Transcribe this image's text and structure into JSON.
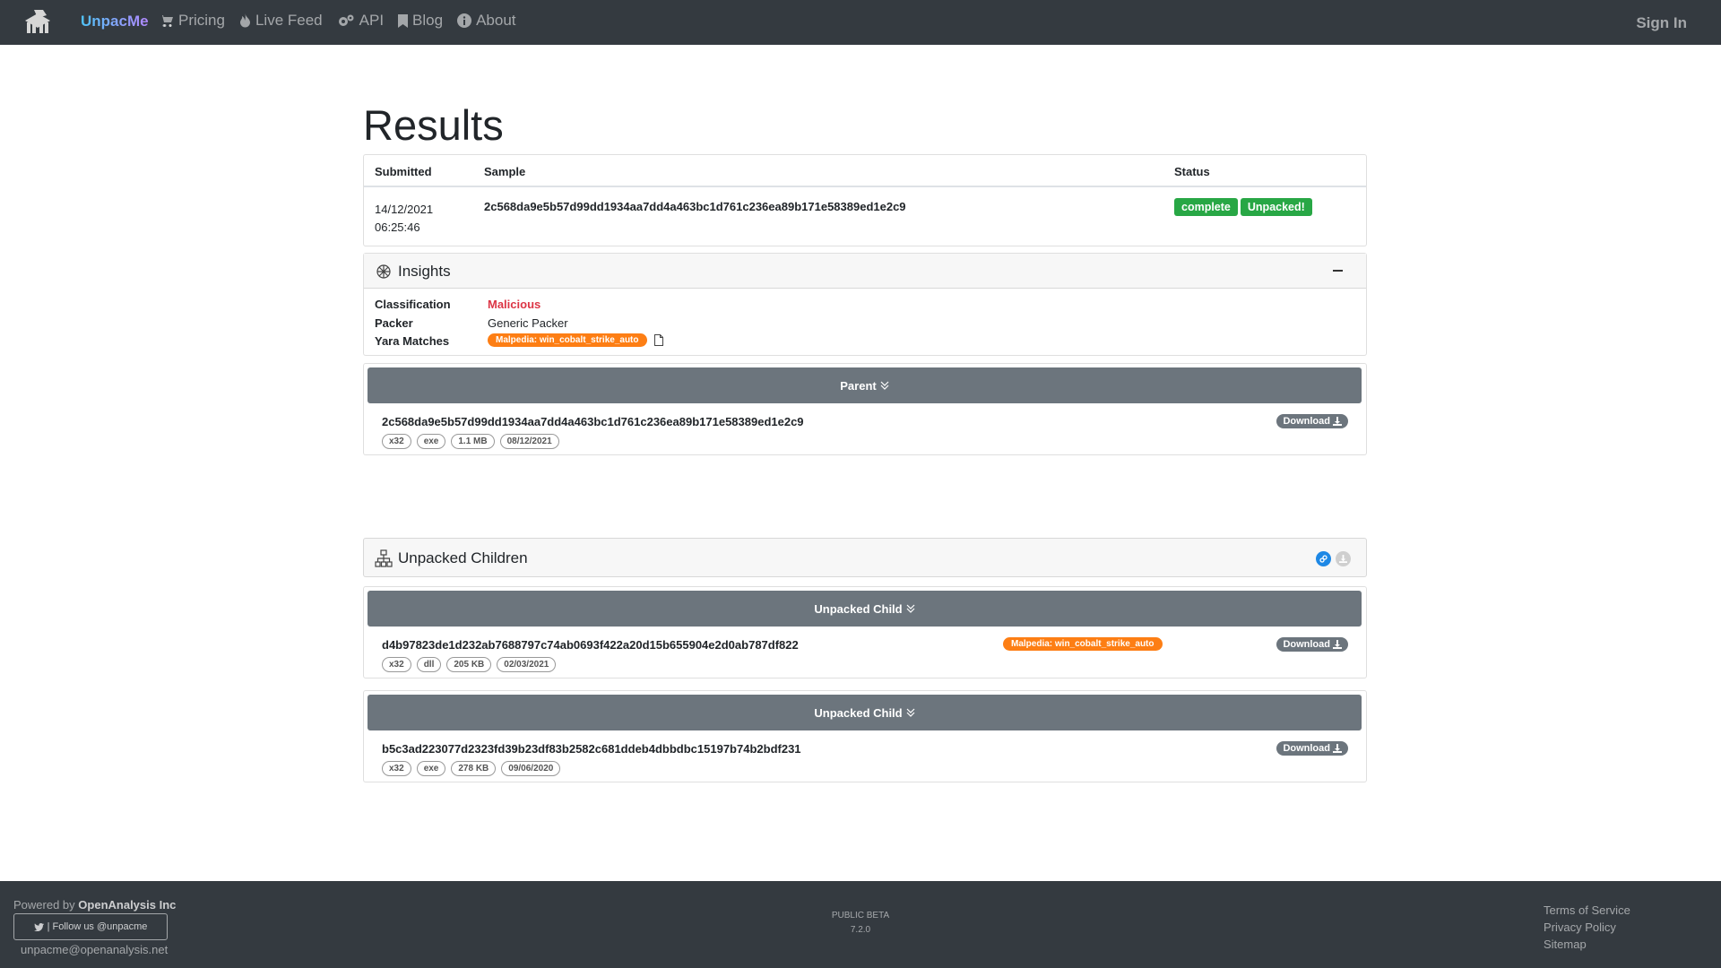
{
  "nav": {
    "brand": "UnpacMe",
    "links": [
      {
        "label": "Pricing",
        "icon": "cart-icon"
      },
      {
        "label": "Live Feed",
        "icon": "fire-icon"
      },
      {
        "label": "API",
        "icon": "cogs-icon"
      },
      {
        "label": "Blog",
        "icon": "bookmark-icon"
      },
      {
        "label": "About",
        "icon": "info-icon"
      }
    ],
    "signin": "Sign In"
  },
  "page": {
    "title": "Results"
  },
  "results": {
    "headers": {
      "submitted": "Submitted",
      "sample": "Sample",
      "status": "Status"
    },
    "submitted_date": "14/12/2021",
    "submitted_time": "06:25:46",
    "sample": "2c568da9e5b57d99dd1934aa7dd4a463bc1d761c236ea89b171e58389ed1e2c9",
    "status": [
      "complete",
      "Unpacked!"
    ],
    "status_color": "#28a745"
  },
  "insights": {
    "title": "Insights",
    "classification_label": "Classification",
    "classification": "Malicious",
    "packer_label": "Packer",
    "packer": "Generic Packer",
    "yara_label": "Yara Matches",
    "yara": "Malpedia: win_cobalt_strike_auto",
    "malicious_color": "#dc3545",
    "yara_color": "#fd7e14"
  },
  "parent": {
    "bar_label": "Parent",
    "hash": "2c568da9e5b57d99dd1934aa7dd4a463bc1d761c236ea89b171e58389ed1e2c9",
    "tags": [
      "x32",
      "exe",
      "1.1 MB",
      "08/12/2021"
    ],
    "download": "Download"
  },
  "children": {
    "title": "Unpacked Children",
    "items": [
      {
        "bar_label": "Unpacked Child",
        "hash": "d4b97823de1d232ab7688797c74ab0693f422a20d15b655904e2d0ab787df822",
        "yara": "Malpedia: win_cobalt_strike_auto",
        "tags": [
          "x32",
          "dll",
          "205 KB",
          "02/03/2021"
        ],
        "download": "Download"
      },
      {
        "bar_label": "Unpacked Child",
        "hash": "b5c3ad223077d2323fd39b23df83b2582c681ddeb4dbbdbc15197b74b2bdf231",
        "tags": [
          "x32",
          "exe",
          "278 KB",
          "09/06/2020"
        ],
        "download": "Download"
      }
    ]
  },
  "footer": {
    "powered_prefix": "Powered by",
    "powered_org": "OpenAnalysis Inc",
    "follow": "| Follow us @unpacme",
    "email": "unpacme@openanalysis.net",
    "beta": "PUBLIC BETA",
    "version": "7.2.0",
    "links": [
      "Terms of Service",
      "Privacy Policy",
      "Sitemap"
    ]
  }
}
